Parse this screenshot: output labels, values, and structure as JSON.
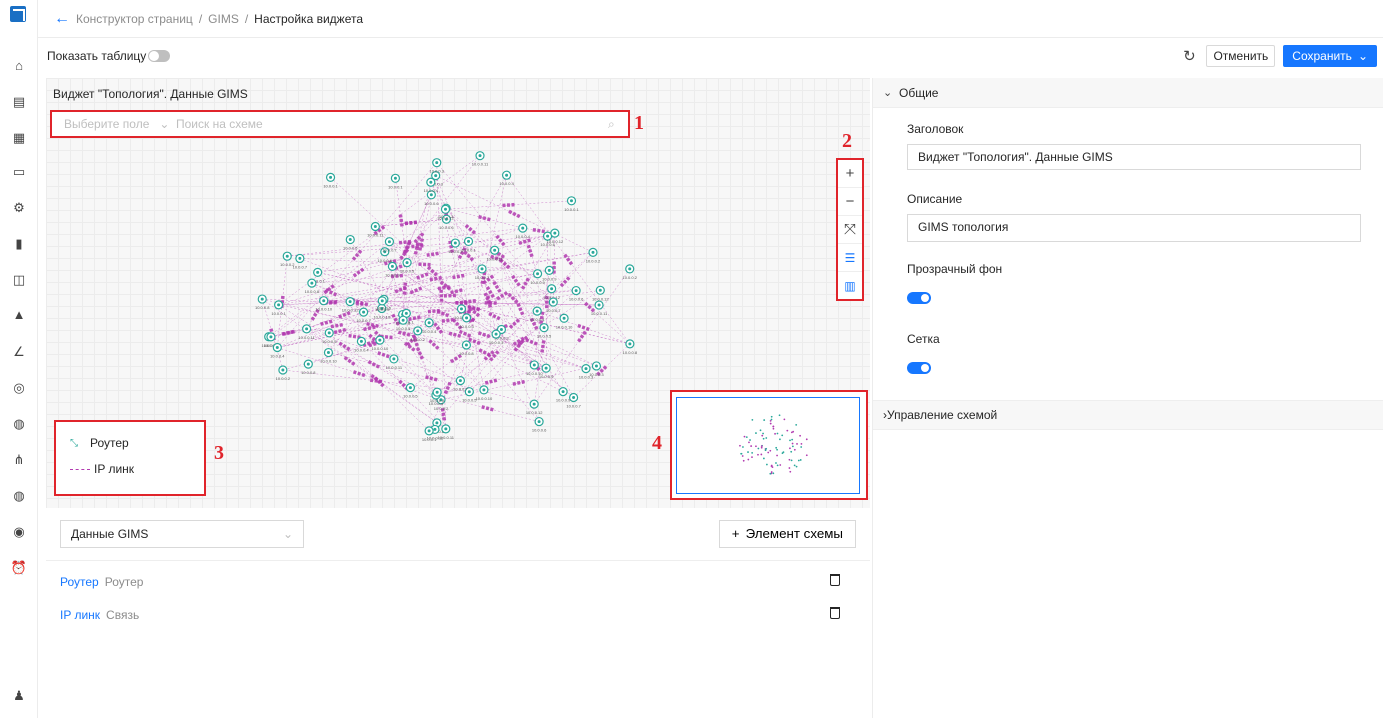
{
  "breadcrumb": {
    "items": [
      "Конструктор страниц",
      "GIMS"
    ],
    "current": "Настройка виджета"
  },
  "toolbar": {
    "show_table_label": "Показать таблицу",
    "show_table_enabled": false,
    "cancel_label": "Отменить",
    "save_label": "Сохранить"
  },
  "canvas": {
    "widget_title": "Виджет \"Топология\". Данные GIMS",
    "field_select_placeholder": "Выберите поле",
    "search_placeholder": "Поиск на схеме",
    "markers": [
      "1",
      "2",
      "3",
      "4"
    ],
    "node_labels": [
      "10.0.0.1",
      "10.0.0.2",
      "10.0.0.3",
      "10.0.0.4",
      "10.0.0.5",
      "10.0.0.6",
      "10.0.0.7",
      "10.0.0.8",
      "10.0.0.9",
      "10.0.0.10",
      "10.0.0.11",
      "10.0.0.12"
    ],
    "colors": {
      "router": "#2aa89a",
      "link": "#b23bb0",
      "marker": "#e0242b"
    }
  },
  "zoom_controls": {
    "zoom_in": "+",
    "zoom_out": "−",
    "fit": "fit-icon",
    "legend": "list-icon",
    "map": "map-icon"
  },
  "legend": {
    "items": [
      {
        "label": "Роутер",
        "icon": "router-icon"
      },
      {
        "label": "IP линк",
        "icon": "link-icon"
      }
    ]
  },
  "bottom": {
    "data_source": "Данные GIMS",
    "add_element_label": "Элемент схемы",
    "rows": [
      {
        "name": "Роутер",
        "type": "Роутер"
      },
      {
        "name": "IP линк",
        "type": "Связь"
      }
    ]
  },
  "right_panel": {
    "general_section": "Общие",
    "title_label": "Заголовок",
    "title_value": "Виджет \"Топология\". Данные GIMS",
    "description_label": "Описание",
    "description_value": "GIMS топология",
    "transparent_bg_label": "Прозрачный фон",
    "transparent_bg_enabled": true,
    "grid_label": "Сетка",
    "grid_enabled": true,
    "scheme_section": "Управление схемой"
  },
  "accent_color": "#1677ff"
}
